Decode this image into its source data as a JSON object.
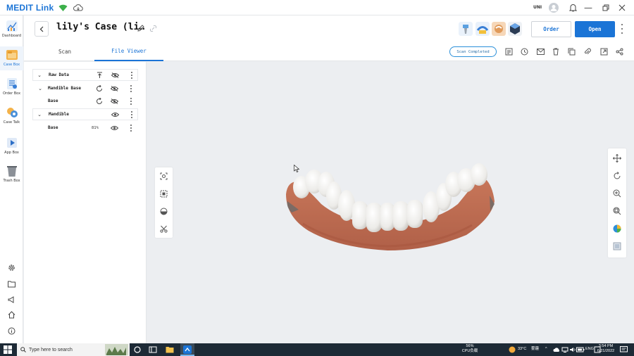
{
  "app": {
    "brand": "MEDIT Link",
    "user_short": "UNI"
  },
  "sidebar": {
    "items": [
      {
        "label": "Dashboard",
        "color": "#4a90d9"
      },
      {
        "label": "Case Box",
        "color": "#f2a93b",
        "active": true
      },
      {
        "label": "Order Box",
        "color": "#5aa0e0"
      },
      {
        "label": "Case Talk",
        "color": "#f0b23a"
      },
      {
        "label": "App Box",
        "color": "#3b7fd4"
      },
      {
        "label": "Trash Box",
        "color": "#7a7f87"
      }
    ],
    "bottom_icons": [
      "settings-icon",
      "folder-icon",
      "megaphone-icon",
      "home-icon",
      "info-icon"
    ]
  },
  "header": {
    "case_title": "lily's Case (li…",
    "order_label": "Order",
    "open_label": "Open",
    "apps": [
      "implant-app-icon",
      "ortho-app-icon",
      "design-app-icon",
      "cube-app-icon"
    ]
  },
  "tabs": [
    {
      "label": "Scan",
      "active": false
    },
    {
      "label": "File Viewer",
      "active": true
    }
  ],
  "status": {
    "label": "Scan Completed"
  },
  "data_panel": {
    "rows": [
      {
        "name": "Raw Data",
        "level": 0,
        "expand": true,
        "group": true
      },
      {
        "name": "Mandible Base",
        "level": 1,
        "expand": true,
        "group": false
      },
      {
        "name": "Base",
        "level": 2,
        "expand": false,
        "group": false
      },
      {
        "name": "Mandible",
        "level": 0,
        "expand": true,
        "group": true
      },
      {
        "name": "Base",
        "level": 2,
        "expand": false,
        "group": false,
        "percent": "81%"
      }
    ]
  },
  "taskbar": {
    "search_placeholder": "Type here to search",
    "cpu_percent": "56%",
    "cpu_label": "CPU负载",
    "temperature": "33°C",
    "weather": "雾霾",
    "lang": "ENG",
    "time": "3:54 PM",
    "date": "6/21/2022"
  }
}
